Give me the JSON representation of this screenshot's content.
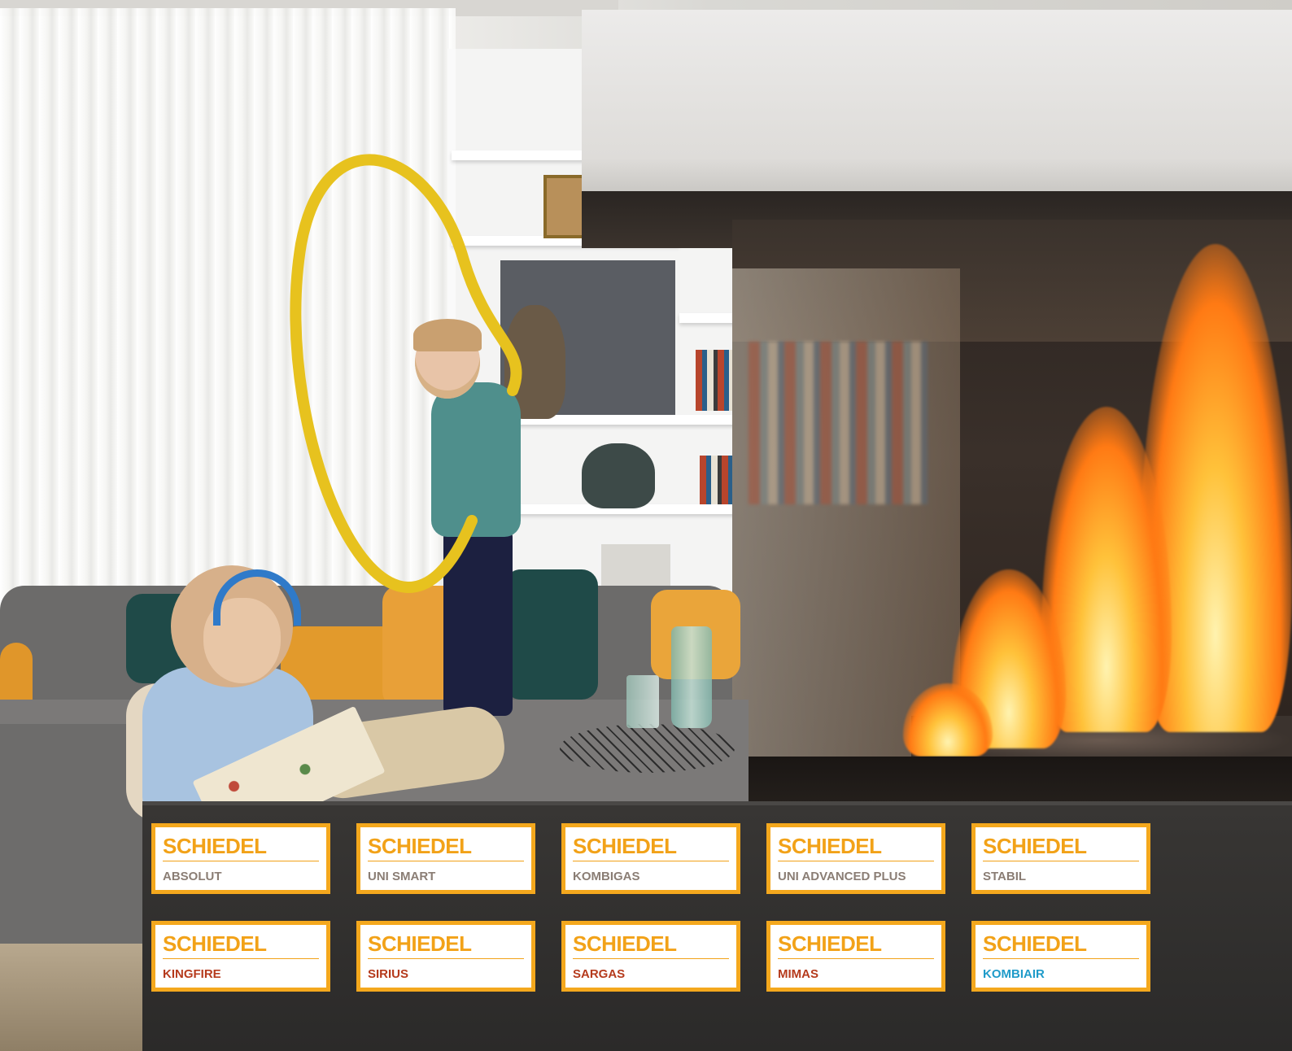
{
  "brand": "SCHIEDEL",
  "colors": {
    "brand_orange": "#f2a218",
    "product_grey": "#8a7d74",
    "product_red": "#b53a1c",
    "product_blue": "#1f9bc9"
  },
  "products": [
    {
      "name": "ABSOLUT",
      "color": "#8a7d74"
    },
    {
      "name": "UNI SMART",
      "color": "#8a7d74"
    },
    {
      "name": "KOMBIGAS",
      "color": "#8a7d74"
    },
    {
      "name": "UNI ADVANCED PLUS",
      "color": "#8a7d74"
    },
    {
      "name": "STABIL",
      "color": "#8a7d74"
    },
    {
      "name": "KINGFIRE",
      "color": "#b53a1c"
    },
    {
      "name": "SIRIUS",
      "color": "#b53a1c"
    },
    {
      "name": "SARGAS",
      "color": "#b53a1c"
    },
    {
      "name": "MIMAS",
      "color": "#b53a1c"
    },
    {
      "name": "KOMBIAIR",
      "color": "#1f9bc9"
    }
  ]
}
